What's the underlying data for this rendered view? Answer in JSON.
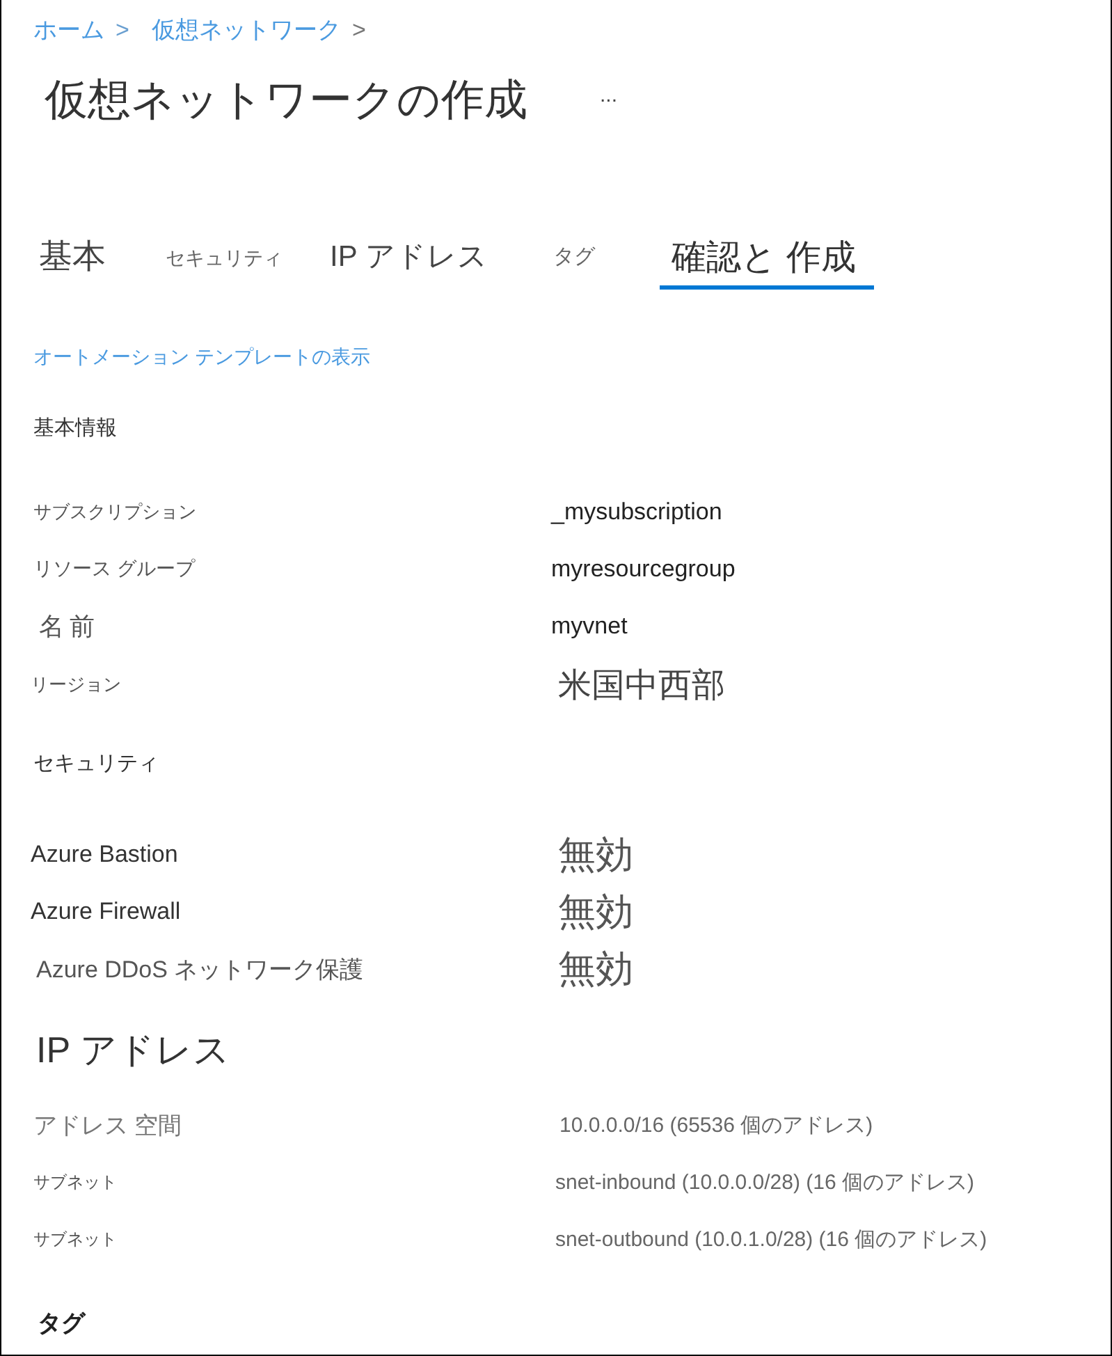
{
  "breadcrumb": [
    {
      "label": "ホーム",
      "separator": ">"
    },
    {
      "label": "仮想ネットワーク",
      "separator": ">"
    }
  ],
  "title": "仮想ネットワークの作成",
  "more_button": "...",
  "tabs": [
    {
      "label": "基本",
      "selected": false
    },
    {
      "label": "セキュリティ",
      "selected": false
    },
    {
      "label": "IP アドレス",
      "selected": false
    },
    {
      "label": "タグ",
      "selected": false
    },
    {
      "label": "確認と 作成",
      "selected": true
    }
  ],
  "automation_link": "オートメーション テンプレートの表示",
  "sections": [
    {
      "heading": "基本情報",
      "rows": [
        {
          "label": "サブスクリプション",
          "value": "_mysubscription"
        },
        {
          "label": "リソース グループ",
          "value": "myresourcegroup"
        },
        {
          "label": "名前",
          "value": "myvnet"
        },
        {
          "label": "リージョン",
          "value": "米国中西部"
        }
      ]
    },
    {
      "heading": "セキュリティ",
      "rows": [
        {
          "label": "Azure Bastion",
          "value": "無効"
        },
        {
          "label": "Azure Firewall",
          "value": "無効"
        },
        {
          "label": "Azure DDoS ネットワーク保護",
          "value": "無効"
        }
      ]
    },
    {
      "heading": "IP アドレス",
      "rows": [
        {
          "label": "アドレス 空間",
          "value": "10.0.0.0/16 (65536 個のアドレス)"
        },
        {
          "label": "サブネット",
          "value": "snet-inbound (10.0.0.0/28) (16 個のアドレス)"
        },
        {
          "label": "サブネット",
          "value": "snet-outbound (10.0.1.0/28) (16 個のアドレス)"
        }
      ]
    },
    {
      "heading": "タグ"
    }
  ]
}
